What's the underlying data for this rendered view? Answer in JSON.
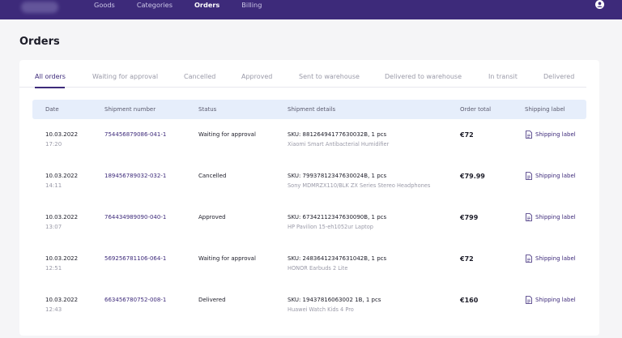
{
  "nav": {
    "items": [
      {
        "label": "Goods",
        "active": false
      },
      {
        "label": "Categories",
        "active": false
      },
      {
        "label": "Orders",
        "active": true
      },
      {
        "label": "Billing",
        "active": false
      }
    ]
  },
  "page": {
    "title": "Orders"
  },
  "tabs": [
    {
      "label": "All orders",
      "active": true
    },
    {
      "label": "Waiting for approval",
      "active": false
    },
    {
      "label": "Cancelled",
      "active": false
    },
    {
      "label": "Approved",
      "active": false
    },
    {
      "label": "Sent to warehouse",
      "active": false
    },
    {
      "label": "Delivered to warehouse",
      "active": false
    },
    {
      "label": "In transit",
      "active": false
    },
    {
      "label": "Delivered",
      "active": false
    }
  ],
  "table": {
    "headers": {
      "date": "Date",
      "shipment_number": "Shipment number",
      "status": "Status",
      "shipment_details": "Shipment details",
      "order_total": "Order total",
      "shipping_label": "Shipping label"
    },
    "rows": [
      {
        "date": "10.03.2022",
        "time": "17:20",
        "shipment_number": "754456879086-041-1",
        "status": "Waiting for approval",
        "sku": "SKU: 88126494177630032B, 1 pcs",
        "product": "Xiaomi Smart Antibacterial Humidifier",
        "total": "€72",
        "label": "Shipping label"
      },
      {
        "date": "10.03.2022",
        "time": "14:11",
        "shipment_number": "189456789032-032-1",
        "status": "Cancelled",
        "sku": "SKU: 79937812347630024B, 1 pcs",
        "product": "Sony MDMRZX110/BLK ZX Series Stereo Headphones",
        "total": "€79.99",
        "label": "Shipping label"
      },
      {
        "date": "10.03.2022",
        "time": "13:07",
        "shipment_number": "764434989090-040-1",
        "status": "Approved",
        "sku": "SKU: 67342112347630090B, 1 pcs",
        "product": "HP Pavilion 15-eh1052ur Laptop",
        "total": "€799",
        "label": "Shipping label"
      },
      {
        "date": "10.03.2022",
        "time": "12:51",
        "shipment_number": "569256781106-064-1",
        "status": "Waiting for approval",
        "sku": "SKU: 24836412347631042B, 1 pcs",
        "product": "HONOR Earbuds 2 Lite",
        "total": "€72",
        "label": "Shipping label"
      },
      {
        "date": "10.03.2022",
        "time": "12:43",
        "shipment_number": "663456780752-008-1",
        "status": "Delivered",
        "sku": "SKU: 19437816063002 1B, 1 pcs",
        "product": "Huawei Watch Kids 4 Pro",
        "total": "€160",
        "label": "Shipping label"
      }
    ]
  },
  "icons": {
    "user": "user-circle-icon",
    "label": "document-icon"
  },
  "colors": {
    "brand": "#3d2a7a",
    "header_bg": "#e6eefb"
  }
}
